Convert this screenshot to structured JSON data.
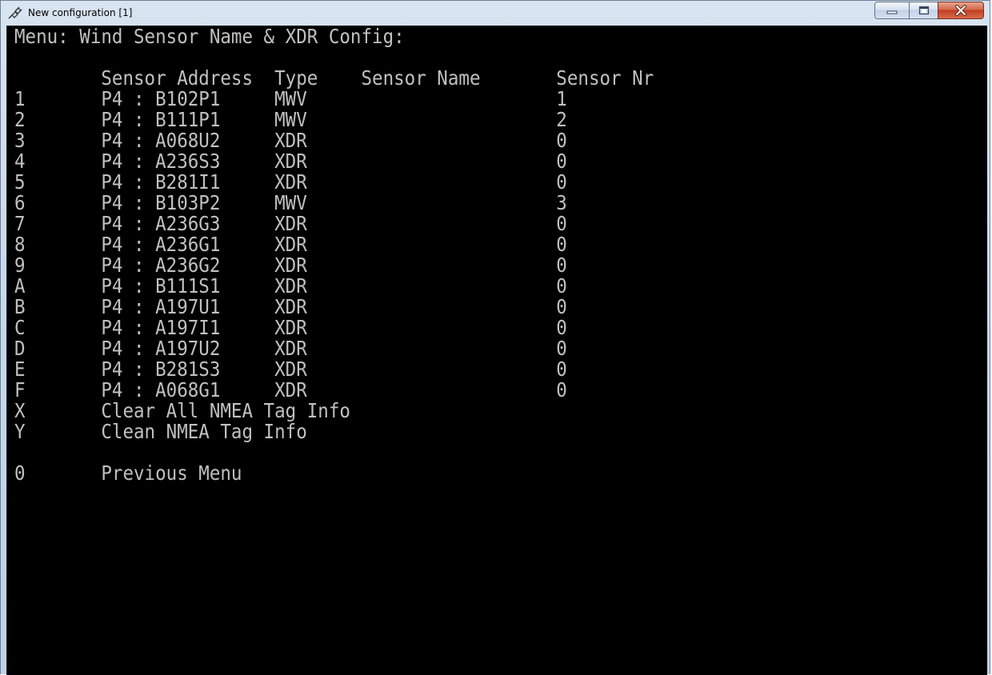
{
  "window": {
    "title": "New configuration [1]",
    "controls": [
      "minimize",
      "maximize",
      "close"
    ]
  },
  "terminal": {
    "lines": [
      "Menu: Wind Sensor Name & XDR Config:",
      "",
      "        Sensor Address  Type    Sensor Name       Sensor Nr",
      "1       P4 : B102P1     MWV                       1",
      "2       P4 : B111P1     MWV                       2",
      "3       P4 : A068U2     XDR                       0",
      "4       P4 : A236S3     XDR                       0",
      "5       P4 : B281I1     XDR                       0",
      "6       P4 : B103P2     MWV                       3",
      "7       P4 : A236G3     XDR                       0",
      "8       P4 : A236G1     XDR                       0",
      "9       P4 : A236G2     XDR                       0",
      "A       P4 : B111S1     XDR                       0",
      "B       P4 : A197U1     XDR                       0",
      "C       P4 : A197I1     XDR                       0",
      "D       P4 : A197U2     XDR                       0",
      "E       P4 : B281S3     XDR                       0",
      "F       P4 : A068G1     XDR                       0",
      "X       Clear All NMEA Tag Info",
      "Y       Clean NMEA Tag Info",
      "",
      "0       Previous Menu"
    ]
  }
}
